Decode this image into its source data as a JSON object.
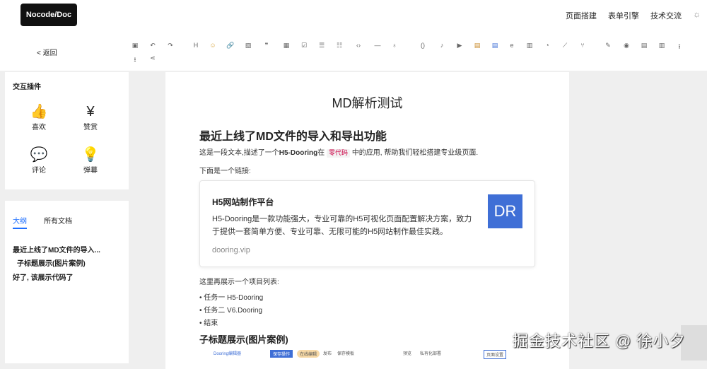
{
  "header": {
    "logo": "Nocode/Doc",
    "nav": [
      "页面搭建",
      "表单引擎",
      "技术交流"
    ],
    "theme_icon": "sun-icon",
    "back": "< 返回"
  },
  "toolbar": {
    "icons": [
      "save-icon",
      "undo-icon",
      "redo-icon",
      "heading-icon",
      "emoji-icon",
      "link-icon",
      "image-icon",
      "quote-icon",
      "table-icon",
      "checkbox-icon",
      "ordered-list-icon",
      "unordered-list-icon",
      "code-icon",
      "divider-icon",
      "alert-icon",
      "formula-icon",
      "audio-icon",
      "video-icon",
      "pdf-icon",
      "word-icon",
      "edge-icon",
      "bar-chart-icon",
      "pie-chart-icon",
      "line-chart-icon",
      "flow-icon",
      "sign-icon",
      "preview-icon",
      "markdown-icon",
      "building-icon",
      "export-icon",
      "import-icon",
      "share-icon"
    ],
    "glyphs": [
      "▣",
      "↶",
      "↷",
      "H",
      "☺",
      "🔗",
      "▨",
      "❞",
      "▦",
      "☑",
      "☰",
      "☷",
      "‹›",
      "—",
      "♁",
      "()",
      "♪",
      "▶",
      "▤",
      "▤",
      "e",
      "▥",
      "◔",
      "⟋",
      "⑂",
      "✎",
      "◉",
      "▤",
      "▥",
      "⭱",
      "⭳",
      "⋖"
    ]
  },
  "plugins": {
    "title": "交互插件",
    "items": [
      {
        "icon": "thumbs-up-icon",
        "glyph": "👍",
        "label": "喜欢"
      },
      {
        "icon": "yen-icon",
        "glyph": "¥",
        "label": "赞赏"
      },
      {
        "icon": "comment-icon",
        "glyph": "💬",
        "label": "评论"
      },
      {
        "icon": "bulb-icon",
        "glyph": "💡",
        "label": "弹幕"
      }
    ]
  },
  "outline": {
    "tabs": [
      "大纲",
      "所有文档"
    ],
    "items": [
      "最近上线了MD文件的导入...",
      "子标题展示(图片案例)",
      "好了, 该展示代码了"
    ]
  },
  "doc": {
    "title": "MD解析测试",
    "h2": "最近上线了MD文件的导入和导出功能",
    "p1_a": "这是一段文本,描述了一个",
    "p1_b": "H5-Dooring",
    "p1_c": "在",
    "p1_code": "零代码",
    "p1_d": "中的应用, 帮助我们轻松搭建专业级页面.",
    "p2": "下面是一个链接:",
    "card": {
      "title": "H5网站制作平台",
      "desc": "H5-Dooring是一款功能强大，专业可靠的H5可视化页面配置解决方案，致力于提供一套简单方便、专业可靠、无限可能的H5网站制作最佳实践。",
      "url": "dooring.vip",
      "logo": "DR"
    },
    "p3": "这里再展示一个项目列表:",
    "list": [
      "任务一 H5-Dooring",
      "任务二 V6.Dooring",
      "结束"
    ],
    "h3": "子标题展示(图片案例)",
    "screenshot": [
      "Dooring编辑器",
      "保存操作",
      "在线编辑",
      "发布",
      "保存模板",
      "预览",
      "私有化部署",
      "页面设置"
    ]
  },
  "watermark": "掘金技术社区 @ 徐小夕"
}
